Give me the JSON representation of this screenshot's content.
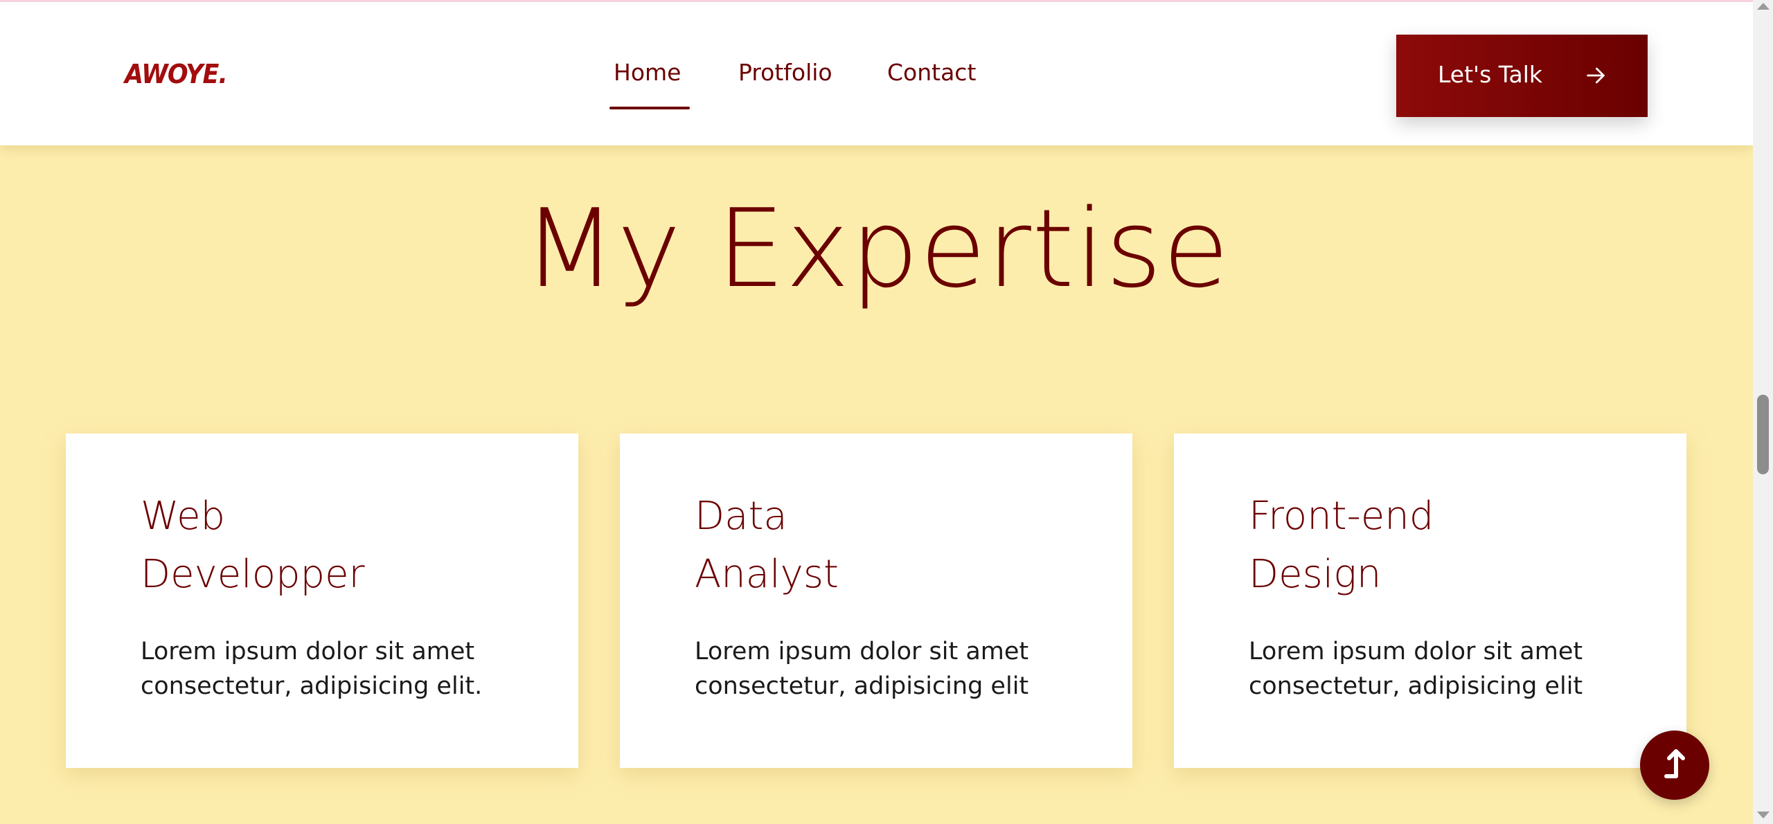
{
  "header": {
    "logo": "AWOYE.",
    "nav": [
      {
        "label": "Home",
        "active": true
      },
      {
        "label": "Protfolio",
        "active": false
      },
      {
        "label": "Contact",
        "active": false
      }
    ],
    "cta_label": "Let's Talk",
    "cta_icon": "arrow-right-icon"
  },
  "section": {
    "title": "My Expertise",
    "cards": [
      {
        "title_line1": "Web",
        "title_line2": "Developper",
        "text_line1": "Lorem ipsum dolor sit amet",
        "text_line2": "consectetur, adipisicing elit."
      },
      {
        "title_line1": "Data",
        "title_line2": "Analyst",
        "text_line1": "Lorem ipsum dolor sit amet",
        "text_line2": "consectetur, adipisicing elit"
      },
      {
        "title_line1": "Front-end",
        "title_line2": "Design",
        "text_line1": "Lorem ipsum dolor sit amet",
        "text_line2": "consectetur, adipisicing elit"
      }
    ]
  },
  "back_to_top_icon": "arrow-up-icon",
  "colors": {
    "brand": "#6b0000",
    "logo": "#a30d0d",
    "background": "#fdedad",
    "card": "#ffffff"
  }
}
